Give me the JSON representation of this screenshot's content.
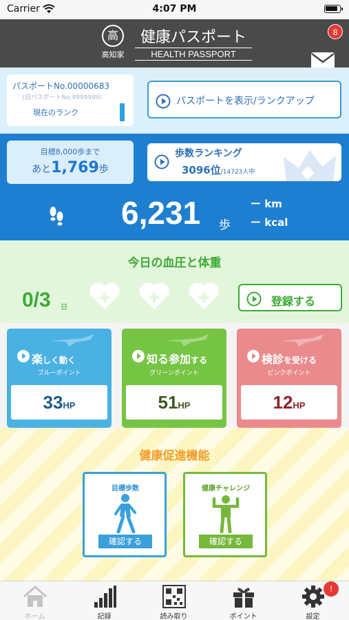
{
  "status_bar": {
    "carrier": "Carrier",
    "time": "4:07 PM"
  },
  "header": {
    "logo_mark": "高",
    "brand": "高知家",
    "title": "健康パスポート",
    "subtitle": "HEALTH PASSPORT",
    "mail_badge": "8"
  },
  "passport": {
    "number": "パスポートNo.00000683",
    "old_number": "(旧パスポートNo.9999999)",
    "current_rank_label": "現在のランク",
    "show_button": "パスポートを表示/ランクアップ"
  },
  "steps": {
    "goal_line": "目標8,000歩まで",
    "remaining_prefix": "あと",
    "remaining_value": "1,769",
    "remaining_unit": "歩",
    "ranking_title": "歩数ランキング",
    "ranking_position": "3096位",
    "ranking_total": "/14723人中",
    "count": "6,231",
    "count_unit": "歩",
    "distance": "ー km",
    "calories": "ー kcal"
  },
  "health": {
    "title": "今日の血圧と体重",
    "count": "0/3",
    "day_unit": "日",
    "register_button": "登録する"
  },
  "points": [
    {
      "title_main": "楽",
      "title_tail": "しく動く",
      "subtitle": "ブルーポイント",
      "value": "33",
      "unit": "HP",
      "color": "#4ab1e3"
    },
    {
      "title_main": "知る参加",
      "title_tail": "する",
      "subtitle": "グリーンポイント",
      "value": "51",
      "unit": "HP",
      "color": "#76c443"
    },
    {
      "title_main": "検診",
      "title_tail": "を受ける",
      "subtitle": "ピンクポイント",
      "value": "12",
      "unit": "HP",
      "color": "#ea8a8c"
    }
  ],
  "promo": {
    "title": "健康促進機能",
    "cards": [
      {
        "title": "目標歩数",
        "button": "確認する",
        "icon": "walking-person-icon"
      },
      {
        "title": "健康チャレンジ",
        "button": "確認する",
        "icon": "flexing-person-icon"
      }
    ]
  },
  "tabbar": {
    "home": "ホーム",
    "record": "記録",
    "scan": "読み取り",
    "points": "ポイント",
    "settings": "設定",
    "settings_badge": "!"
  },
  "colors": {
    "header_bg": "#4a4a4a",
    "steps_bg": "#1e7fd1",
    "health_green": "#3daa35",
    "promo_orange": "#f29e26",
    "badge_red": "#e53935"
  }
}
